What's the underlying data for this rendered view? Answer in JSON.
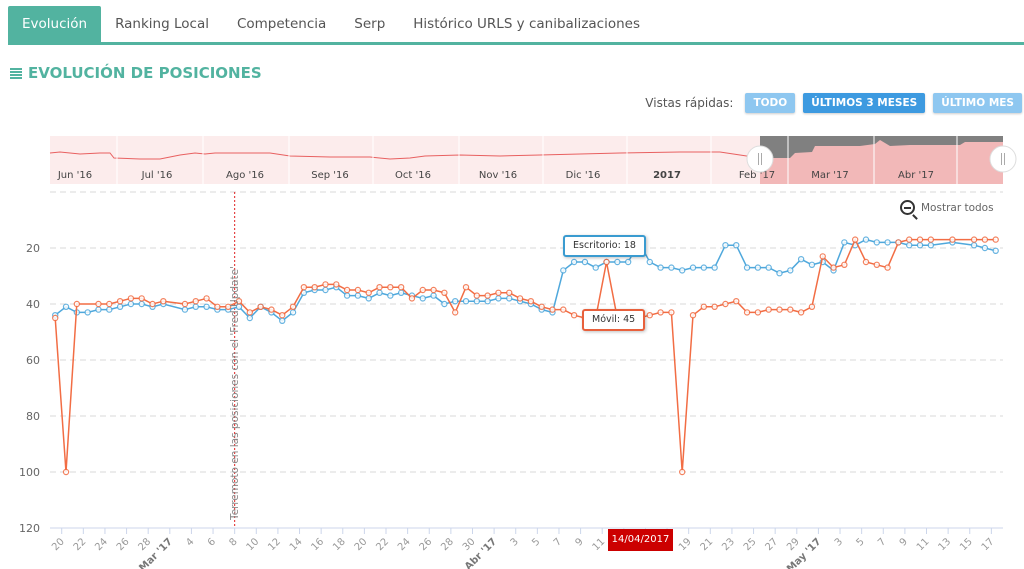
{
  "tabs": [
    {
      "label": "Evolución",
      "active": true
    },
    {
      "label": "Ranking Local",
      "active": false
    },
    {
      "label": "Competencia",
      "active": false
    },
    {
      "label": "Serp",
      "active": false
    },
    {
      "label": "Histórico URLS y canibalizaciones",
      "active": false
    }
  ],
  "section_title": "EVOLUCIÓN DE POSICIONES",
  "section_icon": "list-icon",
  "quick_views": {
    "label": "Vistas rápidas:",
    "buttons": [
      {
        "label": "TODO",
        "selected": false
      },
      {
        "label": "ÚLTIMOS 3 MESES",
        "selected": true
      },
      {
        "label": "ÚLTIMO MES",
        "selected": false
      }
    ]
  },
  "reset_zoom": {
    "label": "Mostrar todos",
    "icon": "zoom-out-icon"
  },
  "colors": {
    "accent": "#52b3a0",
    "desktop": "#4fa8dc",
    "mobile": "#f26d44",
    "plot_line": "#e02020",
    "date_label": "#cc0000"
  },
  "navigator": {
    "labels": [
      "Jun '16",
      "Jul '16",
      "Ago '16",
      "Sep '16",
      "Oct '16",
      "Nov '16",
      "Dic '16",
      "2017",
      "Feb '17",
      "Mar '17",
      "Abr '17"
    ],
    "selected_range": [
      "19/02/2017",
      "17/05/2017"
    ]
  },
  "chart_data": {
    "type": "line",
    "y_reversed": true,
    "ylim": [
      0,
      120
    ],
    "y_ticks": [
      20,
      40,
      60,
      80,
      100,
      120
    ],
    "x_range": [
      "19/02/2017",
      "17/05/2017"
    ],
    "x_tick_labels": [
      "20",
      "22",
      "24",
      "26",
      "28",
      "Mar '17",
      "4",
      "6",
      "8",
      "10",
      "12",
      "14",
      "16",
      "18",
      "20",
      "22",
      "24",
      "26",
      "28",
      "30",
      "Abr '17",
      "3",
      "5",
      "7",
      "9",
      "11",
      "13",
      "15",
      "17",
      "19",
      "21",
      "23",
      "25",
      "27",
      "29",
      "May '17",
      "3",
      "5",
      "7",
      "9",
      "11",
      "13",
      "15",
      "17"
    ],
    "grid": true,
    "plot_line": {
      "date": "08/03/2017",
      "label": "Terremoto en las posiciones con el 'Fred Update'"
    },
    "series": [
      {
        "name": "Escritorio",
        "values": [
          44,
          41,
          43,
          43,
          42,
          42,
          41,
          40,
          40,
          41,
          40,
          null,
          42,
          41,
          41,
          42,
          42,
          41,
          45,
          41,
          43,
          46,
          43,
          36,
          35,
          35,
          34,
          37,
          37,
          38,
          36,
          37,
          36,
          37,
          38,
          37,
          40,
          39,
          39,
          39,
          39,
          38,
          38,
          39,
          40,
          42,
          43,
          28,
          25,
          25,
          27,
          25,
          25,
          25,
          18,
          25,
          27,
          27,
          28,
          27,
          27,
          27,
          19,
          19,
          27,
          27,
          27,
          29,
          28,
          24,
          26,
          25,
          28,
          18,
          19,
          17,
          18,
          18,
          18,
          19,
          19,
          19,
          null,
          18,
          null,
          19,
          20,
          21
        ]
      },
      {
        "name": "Móvil",
        "values": [
          45,
          100,
          40,
          null,
          40,
          40,
          39,
          38,
          38,
          40,
          39,
          null,
          40,
          39,
          38,
          41,
          41,
          39,
          43,
          41,
          42,
          44,
          41,
          34,
          34,
          33,
          33,
          35,
          35,
          36,
          34,
          34,
          34,
          38,
          35,
          35,
          36,
          43,
          34,
          37,
          37,
          36,
          36,
          38,
          39,
          41,
          42,
          42,
          44,
          45,
          45,
          25,
          45,
          45,
          45,
          44,
          43,
          43,
          100,
          44,
          41,
          41,
          40,
          39,
          43,
          43,
          42,
          42,
          42,
          43,
          41,
          23,
          27,
          26,
          17,
          25,
          26,
          27,
          18,
          17,
          17,
          17,
          null,
          17,
          null,
          17,
          17,
          17
        ]
      }
    ],
    "tooltip": {
      "date": "14/04/2017",
      "items": [
        {
          "series": "Escritorio",
          "value": 18,
          "text": "Escritorio: 18"
        },
        {
          "series": "Móvil",
          "value": 45,
          "text": "Móvil: 45"
        }
      ]
    }
  }
}
